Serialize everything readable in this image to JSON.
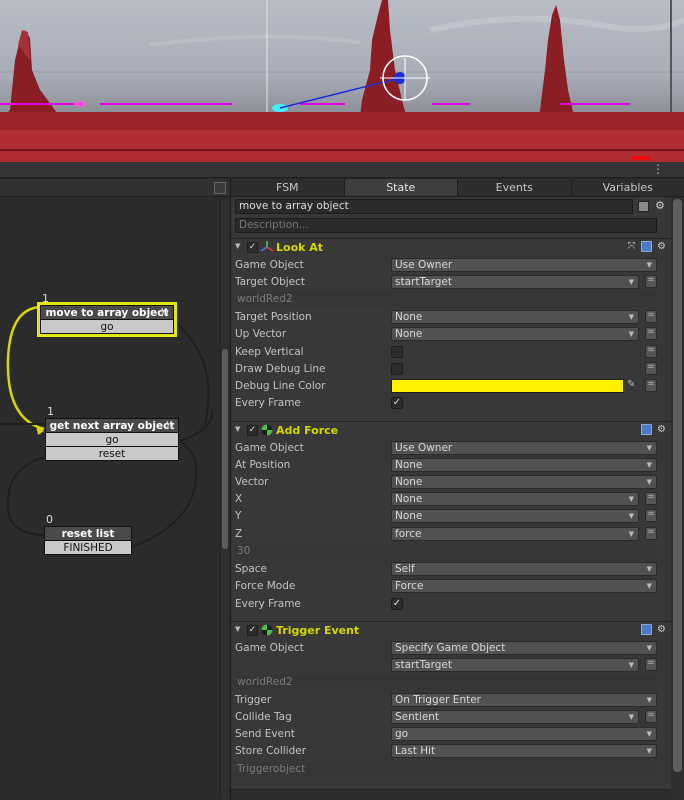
{
  "fsm_tabs": [
    "FSM",
    "State",
    "Events",
    "Variables"
  ],
  "active_tab": "State",
  "state": {
    "name": "move to array object",
    "description_placeholder": "Description..."
  },
  "graph": {
    "nodes": [
      {
        "name": "move to array object",
        "count": "1",
        "events": [
          "go"
        ],
        "selected": true
      },
      {
        "name": "get next array object",
        "count": "1",
        "events": [
          "go",
          "reset"
        ],
        "selected": false
      },
      {
        "name": "reset list",
        "count": "0",
        "events": [
          "FINISHED"
        ],
        "selected": false
      }
    ]
  },
  "actions": {
    "look_at": {
      "name": "Look At",
      "game_object": {
        "label": "Game Object",
        "value": "Use Owner"
      },
      "target_object": {
        "label": "Target Object",
        "value": "startTarget",
        "sub": "worldRed2"
      },
      "target_position": {
        "label": "Target Position",
        "value": "None"
      },
      "up_vector": {
        "label": "Up Vector",
        "value": "None"
      },
      "keep_vertical": {
        "label": "Keep Vertical"
      },
      "draw_debug_line": {
        "label": "Draw Debug Line"
      },
      "debug_line_color": {
        "label": "Debug Line Color",
        "color": "#ffef00"
      },
      "every_frame": {
        "label": "Every Frame",
        "checked": "✓"
      }
    },
    "add_force": {
      "name": "Add Force",
      "game_object": {
        "label": "Game Object",
        "value": "Use Owner"
      },
      "at_position": {
        "label": "At Position",
        "value": "None"
      },
      "vector": {
        "label": "Vector",
        "value": "None"
      },
      "x": {
        "label": "X",
        "value": "None"
      },
      "y": {
        "label": "Y",
        "value": "None"
      },
      "z": {
        "label": "Z",
        "value": "force",
        "sub": "30"
      },
      "space": {
        "label": "Space",
        "value": "Self"
      },
      "force_mode": {
        "label": "Force Mode",
        "value": "Force"
      },
      "every_frame": {
        "label": "Every Frame",
        "checked": "✓"
      }
    },
    "trigger_event": {
      "name": "Trigger Event",
      "game_object": {
        "label": "Game Object",
        "value": "Specify Game Object",
        "value2": "startTarget",
        "sub": "worldRed2"
      },
      "trigger": {
        "label": "Trigger",
        "value": "On Trigger Enter"
      },
      "collide_tag": {
        "label": "Collide Tag",
        "value": "Sentient"
      },
      "send_event": {
        "label": "Send Event",
        "value": "go"
      },
      "store_collider": {
        "label": "Store Collider",
        "value": "Last Hit",
        "sub": "Triggerobject"
      }
    }
  },
  "colors": {
    "selected_node": "#e4e40e",
    "action_title": "#d6d600",
    "magenta_line": "#e000e0",
    "rock": "#8a1e24"
  },
  "icons": {
    "menu": "⋮",
    "fold": "▼",
    "check": "✓",
    "arrow": "▼",
    "finished": "⟩⟩"
  }
}
